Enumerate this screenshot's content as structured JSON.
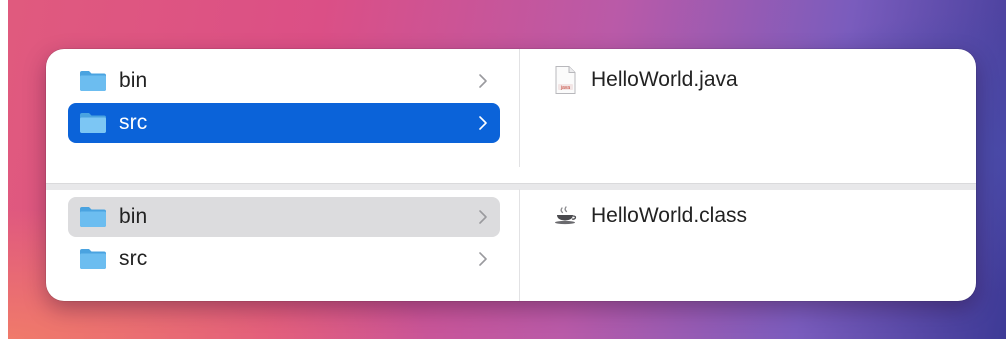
{
  "top_pane": {
    "folders": [
      {
        "label": "bin",
        "selected": false
      },
      {
        "label": "src",
        "selected": true
      }
    ],
    "files": [
      {
        "label": "HelloWorld.java",
        "icon": "java-file-icon",
        "icon_text": "java"
      }
    ]
  },
  "bottom_pane": {
    "folders": [
      {
        "label": "bin",
        "selected": true
      },
      {
        "label": "src",
        "selected": false
      }
    ],
    "files": [
      {
        "label": "HelloWorld.class",
        "icon": "coffee-cup-icon"
      }
    ]
  },
  "colors": {
    "selection_active": "#0b63d9",
    "selection_inactive": "#dcdcde",
    "folder_blue": "#5fb4ec"
  }
}
